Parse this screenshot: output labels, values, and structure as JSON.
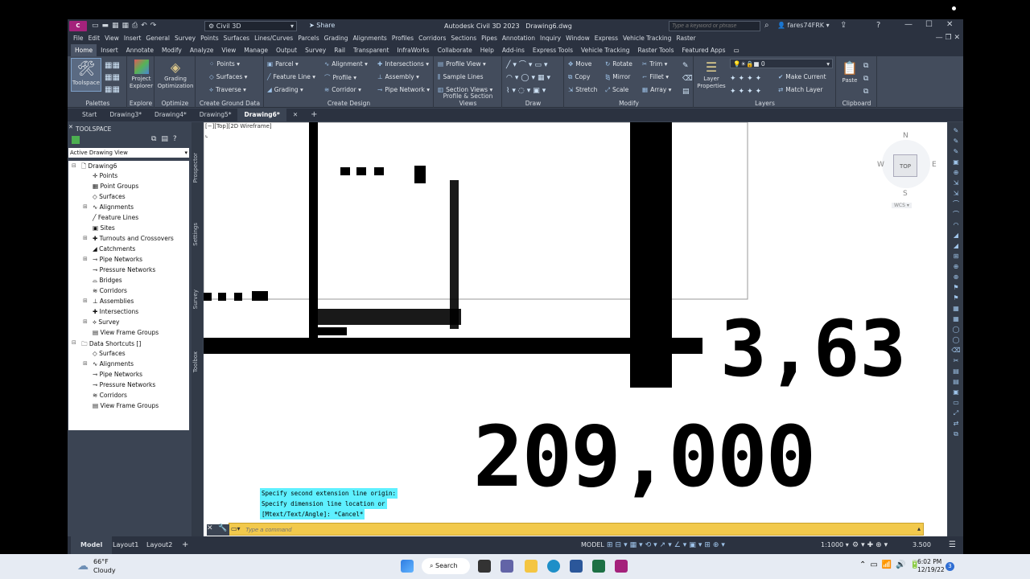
{
  "title": {
    "app": "Autodesk Civil 3D 2023",
    "file": "Drawing6.dwg",
    "workspace": "Civil 3D",
    "share": "Share",
    "search_placeholder": "Type a keyword or phrase",
    "user": "fares74FRK"
  },
  "menu": [
    "File",
    "Edit",
    "View",
    "Insert",
    "General",
    "Survey",
    "Points",
    "Surfaces",
    "Lines/Curves",
    "Parcels",
    "Grading",
    "Alignments",
    "Profiles",
    "Corridors",
    "Sections",
    "Pipes",
    "Annotation",
    "Inquiry",
    "Window",
    "Express",
    "Vehicle Tracking",
    "Raster"
  ],
  "ribbon_tabs": [
    "Home",
    "Insert",
    "Annotate",
    "Modify",
    "Analyze",
    "View",
    "Manage",
    "Output",
    "Survey",
    "Rail",
    "Transparent",
    "InfraWorks",
    "Collaborate",
    "Help",
    "Add-ins",
    "Express Tools",
    "Vehicle Tracking",
    "Raster Tools",
    "Featured Apps"
  ],
  "ribbon": {
    "toolspace": "Toolspace",
    "project_explorer": "Project Explorer",
    "grading_optimization": "Grading Optimization",
    "points": "Points",
    "surfaces": "Surfaces",
    "traverse": "Traverse",
    "parcel": "Parcel",
    "feature_line": "Feature Line",
    "grading": "Grading",
    "alignment": "Alignment",
    "profile": "Profile",
    "corridor": "Corridor",
    "intersections": "Intersections",
    "assembly": "Assembly",
    "pipe_network": "Pipe Network",
    "profile_view": "Profile View",
    "sample_lines": "Sample Lines",
    "section_views": "Section Views",
    "move": "Move",
    "copy": "Copy",
    "stretch": "Stretch",
    "rotate": "Rotate",
    "mirror": "Mirror",
    "scale": "Scale",
    "trim": "Trim",
    "fillet": "Fillet",
    "array": "Array",
    "layer_properties": "Layer Properties",
    "layer_value": "0",
    "make_current": "Make Current",
    "match_layer": "Match Layer",
    "paste": "Paste",
    "panels": {
      "palettes": "Palettes",
      "explore": "Explore",
      "optimize": "Optimize",
      "create_ground": "Create Ground Data",
      "create_design": "Create Design",
      "profile_section": "Profile & Section Views",
      "draw": "Draw",
      "modify": "Modify",
      "layers": "Layers",
      "clipboard": "Clipboard"
    }
  },
  "doc_tabs": [
    "Start",
    "Drawing3*",
    "Drawing4*",
    "Drawing5*",
    "Drawing6*"
  ],
  "toolspace": {
    "title": "TOOLSPACE",
    "view": "Active Drawing View",
    "tree": [
      "Drawing6",
      "Points",
      "Point Groups",
      "Surfaces",
      "Alignments",
      "Feature Lines",
      "Sites",
      "Turnouts and Crossovers",
      "Catchments",
      "Pipe Networks",
      "Pressure Networks",
      "Bridges",
      "Corridors",
      "Assemblies",
      "Intersections",
      "Survey",
      "View Frame Groups",
      "Data Shortcuts []",
      "Surfaces",
      "Alignments",
      "Pipe Networks",
      "Pressure Networks",
      "Corridors",
      "View Frame Groups"
    ],
    "side_tabs": [
      "Prospector",
      "Settings",
      "Survey",
      "Toolbox"
    ]
  },
  "viewport": {
    "label": "[−][Top][2D Wireframe]",
    "text_big": "209,000",
    "text_big2": "3,63",
    "compass": {
      "n": "N",
      "s": "S",
      "e": "E",
      "w": "W",
      "top": "TOP",
      "wcs": "WCS"
    }
  },
  "command": {
    "history": [
      "Specify second extension line origin:",
      "Specify dimension line location or",
      "[Mtext/Text/Angle]: *Cancel*"
    ],
    "placeholder": "Type a command"
  },
  "status": {
    "tabs": [
      "Model",
      "Layout1",
      "Layout2"
    ],
    "model": "MODEL",
    "scale": "1:1000",
    "value": "3.500"
  },
  "taskbar": {
    "temp": "66°F",
    "weather": "Cloudy",
    "search": "Search",
    "time": "6:02 PM",
    "date": "12/19/22",
    "badge": "3"
  },
  "colors": {
    "bg": "#3b4453",
    "dark": "#2b3240",
    "cmd": "#f2c94c",
    "cyan": "#5ef0ff"
  }
}
